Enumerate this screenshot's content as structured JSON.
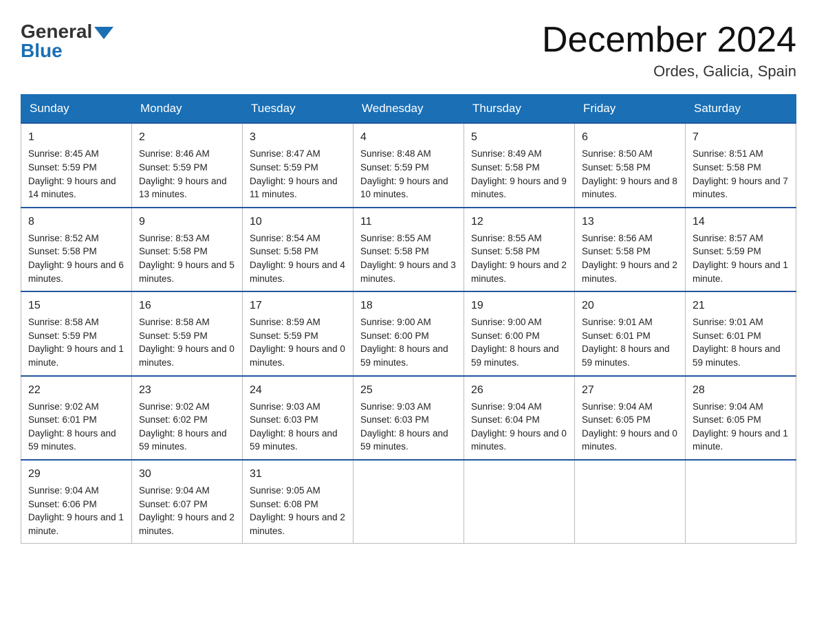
{
  "logo": {
    "general": "General",
    "blue": "Blue"
  },
  "title": "December 2024",
  "location": "Ordes, Galicia, Spain",
  "weekdays": [
    "Sunday",
    "Monday",
    "Tuesday",
    "Wednesday",
    "Thursday",
    "Friday",
    "Saturday"
  ],
  "weeks": [
    [
      {
        "day": "1",
        "sunrise": "8:45 AM",
        "sunset": "5:59 PM",
        "daylight": "9 hours and 14 minutes."
      },
      {
        "day": "2",
        "sunrise": "8:46 AM",
        "sunset": "5:59 PM",
        "daylight": "9 hours and 13 minutes."
      },
      {
        "day": "3",
        "sunrise": "8:47 AM",
        "sunset": "5:59 PM",
        "daylight": "9 hours and 11 minutes."
      },
      {
        "day": "4",
        "sunrise": "8:48 AM",
        "sunset": "5:59 PM",
        "daylight": "9 hours and 10 minutes."
      },
      {
        "day": "5",
        "sunrise": "8:49 AM",
        "sunset": "5:58 PM",
        "daylight": "9 hours and 9 minutes."
      },
      {
        "day": "6",
        "sunrise": "8:50 AM",
        "sunset": "5:58 PM",
        "daylight": "9 hours and 8 minutes."
      },
      {
        "day": "7",
        "sunrise": "8:51 AM",
        "sunset": "5:58 PM",
        "daylight": "9 hours and 7 minutes."
      }
    ],
    [
      {
        "day": "8",
        "sunrise": "8:52 AM",
        "sunset": "5:58 PM",
        "daylight": "9 hours and 6 minutes."
      },
      {
        "day": "9",
        "sunrise": "8:53 AM",
        "sunset": "5:58 PM",
        "daylight": "9 hours and 5 minutes."
      },
      {
        "day": "10",
        "sunrise": "8:54 AM",
        "sunset": "5:58 PM",
        "daylight": "9 hours and 4 minutes."
      },
      {
        "day": "11",
        "sunrise": "8:55 AM",
        "sunset": "5:58 PM",
        "daylight": "9 hours and 3 minutes."
      },
      {
        "day": "12",
        "sunrise": "8:55 AM",
        "sunset": "5:58 PM",
        "daylight": "9 hours and 2 minutes."
      },
      {
        "day": "13",
        "sunrise": "8:56 AM",
        "sunset": "5:58 PM",
        "daylight": "9 hours and 2 minutes."
      },
      {
        "day": "14",
        "sunrise": "8:57 AM",
        "sunset": "5:59 PM",
        "daylight": "9 hours and 1 minute."
      }
    ],
    [
      {
        "day": "15",
        "sunrise": "8:58 AM",
        "sunset": "5:59 PM",
        "daylight": "9 hours and 1 minute."
      },
      {
        "day": "16",
        "sunrise": "8:58 AM",
        "sunset": "5:59 PM",
        "daylight": "9 hours and 0 minutes."
      },
      {
        "day": "17",
        "sunrise": "8:59 AM",
        "sunset": "5:59 PM",
        "daylight": "9 hours and 0 minutes."
      },
      {
        "day": "18",
        "sunrise": "9:00 AM",
        "sunset": "6:00 PM",
        "daylight": "8 hours and 59 minutes."
      },
      {
        "day": "19",
        "sunrise": "9:00 AM",
        "sunset": "6:00 PM",
        "daylight": "8 hours and 59 minutes."
      },
      {
        "day": "20",
        "sunrise": "9:01 AM",
        "sunset": "6:01 PM",
        "daylight": "8 hours and 59 minutes."
      },
      {
        "day": "21",
        "sunrise": "9:01 AM",
        "sunset": "6:01 PM",
        "daylight": "8 hours and 59 minutes."
      }
    ],
    [
      {
        "day": "22",
        "sunrise": "9:02 AM",
        "sunset": "6:01 PM",
        "daylight": "8 hours and 59 minutes."
      },
      {
        "day": "23",
        "sunrise": "9:02 AM",
        "sunset": "6:02 PM",
        "daylight": "8 hours and 59 minutes."
      },
      {
        "day": "24",
        "sunrise": "9:03 AM",
        "sunset": "6:03 PM",
        "daylight": "8 hours and 59 minutes."
      },
      {
        "day": "25",
        "sunrise": "9:03 AM",
        "sunset": "6:03 PM",
        "daylight": "8 hours and 59 minutes."
      },
      {
        "day": "26",
        "sunrise": "9:04 AM",
        "sunset": "6:04 PM",
        "daylight": "9 hours and 0 minutes."
      },
      {
        "day": "27",
        "sunrise": "9:04 AM",
        "sunset": "6:05 PM",
        "daylight": "9 hours and 0 minutes."
      },
      {
        "day": "28",
        "sunrise": "9:04 AM",
        "sunset": "6:05 PM",
        "daylight": "9 hours and 1 minute."
      }
    ],
    [
      {
        "day": "29",
        "sunrise": "9:04 AM",
        "sunset": "6:06 PM",
        "daylight": "9 hours and 1 minute."
      },
      {
        "day": "30",
        "sunrise": "9:04 AM",
        "sunset": "6:07 PM",
        "daylight": "9 hours and 2 minutes."
      },
      {
        "day": "31",
        "sunrise": "9:05 AM",
        "sunset": "6:08 PM",
        "daylight": "9 hours and 2 minutes."
      },
      null,
      null,
      null,
      null
    ]
  ]
}
